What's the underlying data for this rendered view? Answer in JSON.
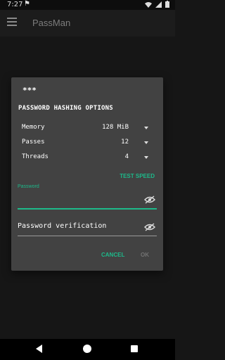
{
  "status_bar": {
    "time": "7:27",
    "notif_icon": "notification-icon"
  },
  "app_bar": {
    "title": "PassMan"
  },
  "dialog": {
    "title": "***",
    "section_title": "PASSWORD HASHING OPTIONS",
    "options": [
      {
        "label": "Memory",
        "value": "128 MiB"
      },
      {
        "label": "Passes",
        "value": "12"
      },
      {
        "label": "Threads",
        "value": "4"
      }
    ],
    "test_speed_label": "TEST SPEED",
    "password": {
      "label": "Password",
      "value": ""
    },
    "password_verification": {
      "placeholder": "Password verification",
      "value": ""
    },
    "cancel_label": "CANCEL",
    "ok_label": "OK"
  },
  "colors": {
    "accent": "#1db98a",
    "dialog_bg": "#424242",
    "background": "#161616"
  }
}
